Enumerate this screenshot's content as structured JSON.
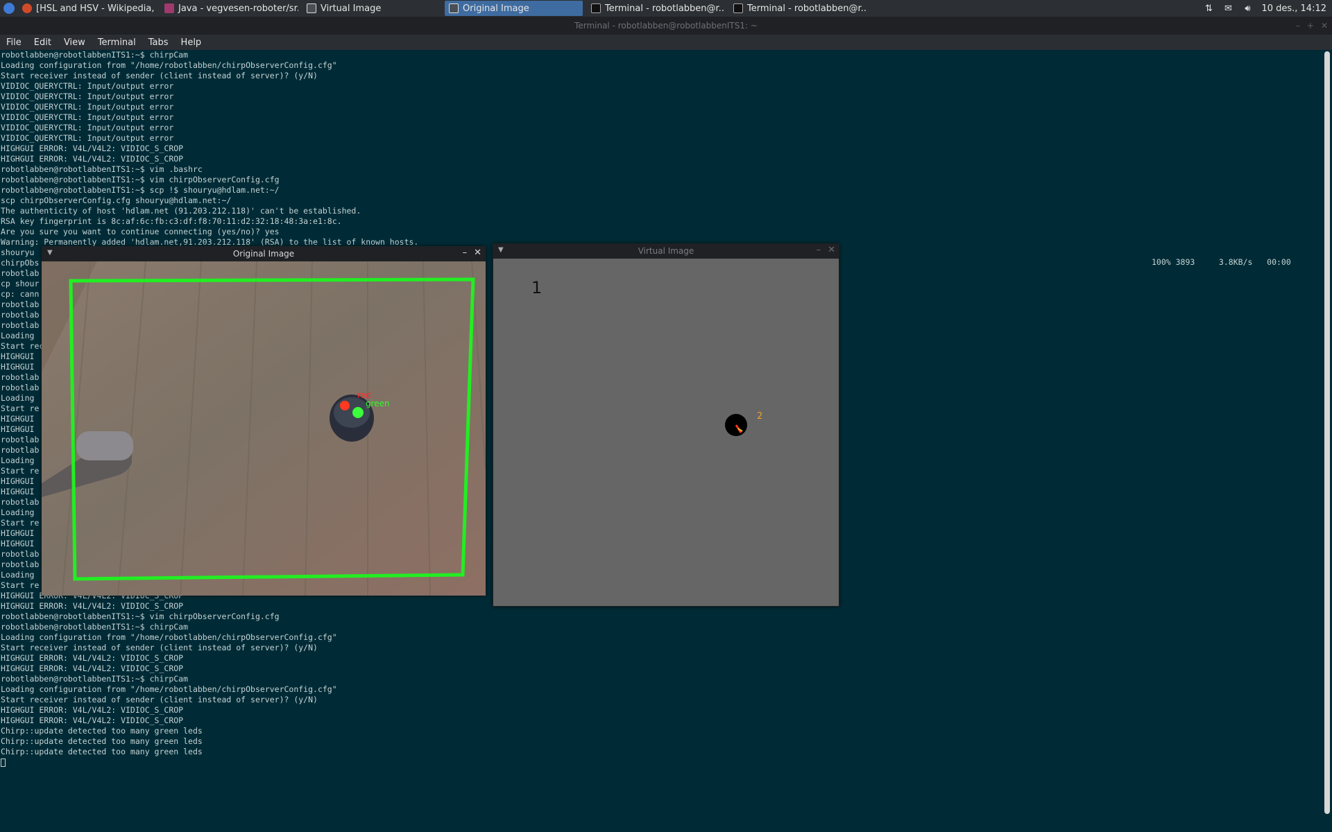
{
  "taskbar": {
    "tasks": [
      {
        "label": "[HSL and HSV - Wikipedia, t...",
        "icon": "firefox-icon",
        "active": false
      },
      {
        "label": "Java - vegvesen-roboter/sr...",
        "icon": "java-icon",
        "active": false
      },
      {
        "label": "Virtual Image",
        "icon": "window-icon",
        "active": false
      },
      {
        "label": "Original Image",
        "icon": "window-icon",
        "active": true
      },
      {
        "label": "Terminal - robotlabben@r...",
        "icon": "terminal-icon",
        "active": false
      },
      {
        "label": "Terminal - robotlabben@r...",
        "icon": "terminal-icon",
        "active": false
      }
    ],
    "clock": "10 des., 14:12"
  },
  "terminal": {
    "title": "Terminal - robotlabben@robotlabbenITS1: ~",
    "menu": [
      "File",
      "Edit",
      "View",
      "Terminal",
      "Tabs",
      "Help"
    ],
    "lines": [
      "robotlabben@robotlabbenITS1:~$ chirpCam",
      "Loading configuration from \"/home/robotlabben/chirpObserverConfig.cfg\"",
      "Start receiver instead of sender (client instead of server)? (y/N)",
      "VIDIOC_QUERYCTRL: Input/output error",
      "VIDIOC_QUERYCTRL: Input/output error",
      "VIDIOC_QUERYCTRL: Input/output error",
      "VIDIOC_QUERYCTRL: Input/output error",
      "VIDIOC_QUERYCTRL: Input/output error",
      "VIDIOC_QUERYCTRL: Input/output error",
      "HIGHGUI ERROR: V4L/V4L2: VIDIOC_S_CROP",
      "HIGHGUI ERROR: V4L/V4L2: VIDIOC_S_CROP",
      "robotlabben@robotlabbenITS1:~$ vim .bashrc",
      "robotlabben@robotlabbenITS1:~$ vim chirpObserverConfig.cfg",
      "robotlabben@robotlabbenITS1:~$ scp !$ shouryu@hdlam.net:~/",
      "scp chirpObserverConfig.cfg shouryu@hdlam.net:~/",
      "The authenticity of host 'hdlam.net (91.203.212.118)' can't be established.",
      "RSA key fingerprint is 8c:af:6c:fb:c3:df:f8:70:11:d2:32:18:48:3a:e1:8c.",
      "Are you sure you want to continue connecting (yes/no)? yes",
      "Warning: Permanently added 'hdlam.net,91.203.212.118' (RSA) to the list of known hosts.",
      "shouryu",
      "chirpObs",
      "robotlab",
      "cp shour",
      "cp: cann",
      "robotlab",
      "robotlab",
      "robotlab",
      "Loading",
      "Start rec",
      "HIGHGUI",
      "HIGHGUI",
      "robotlab",
      "robotlab",
      "Loading",
      "Start re",
      "HIGHGUI",
      "HIGHGUI",
      "robotlab",
      "robotlab",
      "Loading",
      "Start re",
      "HIGHGUI",
      "HIGHGUI",
      "robotlab",
      "Loading",
      "Start re",
      "HIGHGUI",
      "HIGHGUI",
      "robotlab",
      "robotlab",
      "Loading",
      "Start re",
      "HIGHGUI ERROR: V4L/V4L2: VIDIOC_S_CROP",
      "HIGHGUI ERROR: V4L/V4L2: VIDIOC_S_CROP",
      "robotlabben@robotlabbenITS1:~$ vim chirpObserverConfig.cfg",
      "robotlabben@robotlabbenITS1:~$ chirpCam",
      "Loading configuration from \"/home/robotlabben/chirpObserverConfig.cfg\"",
      "Start receiver instead of sender (client instead of server)? (y/N)",
      "HIGHGUI ERROR: V4L/V4L2: VIDIOC_S_CROP",
      "HIGHGUI ERROR: V4L/V4L2: VIDIOC_S_CROP",
      "robotlabben@robotlabbenITS1:~$ chirpCam",
      "Loading configuration from \"/home/robotlabben/chirpObserverConfig.cfg\"",
      "Start receiver instead of sender (client instead of server)? (y/N)",
      "HIGHGUI ERROR: V4L/V4L2: VIDIOC_S_CROP",
      "HIGHGUI ERROR: V4L/V4L2: VIDIOC_S_CROP",
      "Chirp::update detected too many green leds",
      "Chirp::update detected too many green leds",
      "Chirp::update detected too many green leds"
    ],
    "progress_text": "100% 3893     3.8KB/s   00:00"
  },
  "original_window": {
    "title": "Original Image",
    "label_red": "red",
    "label_green": "green"
  },
  "virtual_window": {
    "title": "Virtual Image",
    "marker_1": "1",
    "marker_2": "2"
  },
  "colors": {
    "terminal_bg": "#002b36",
    "detection_box": "#22ee22",
    "virtual_bg": "#666666",
    "marker_label": "#f0a030"
  }
}
